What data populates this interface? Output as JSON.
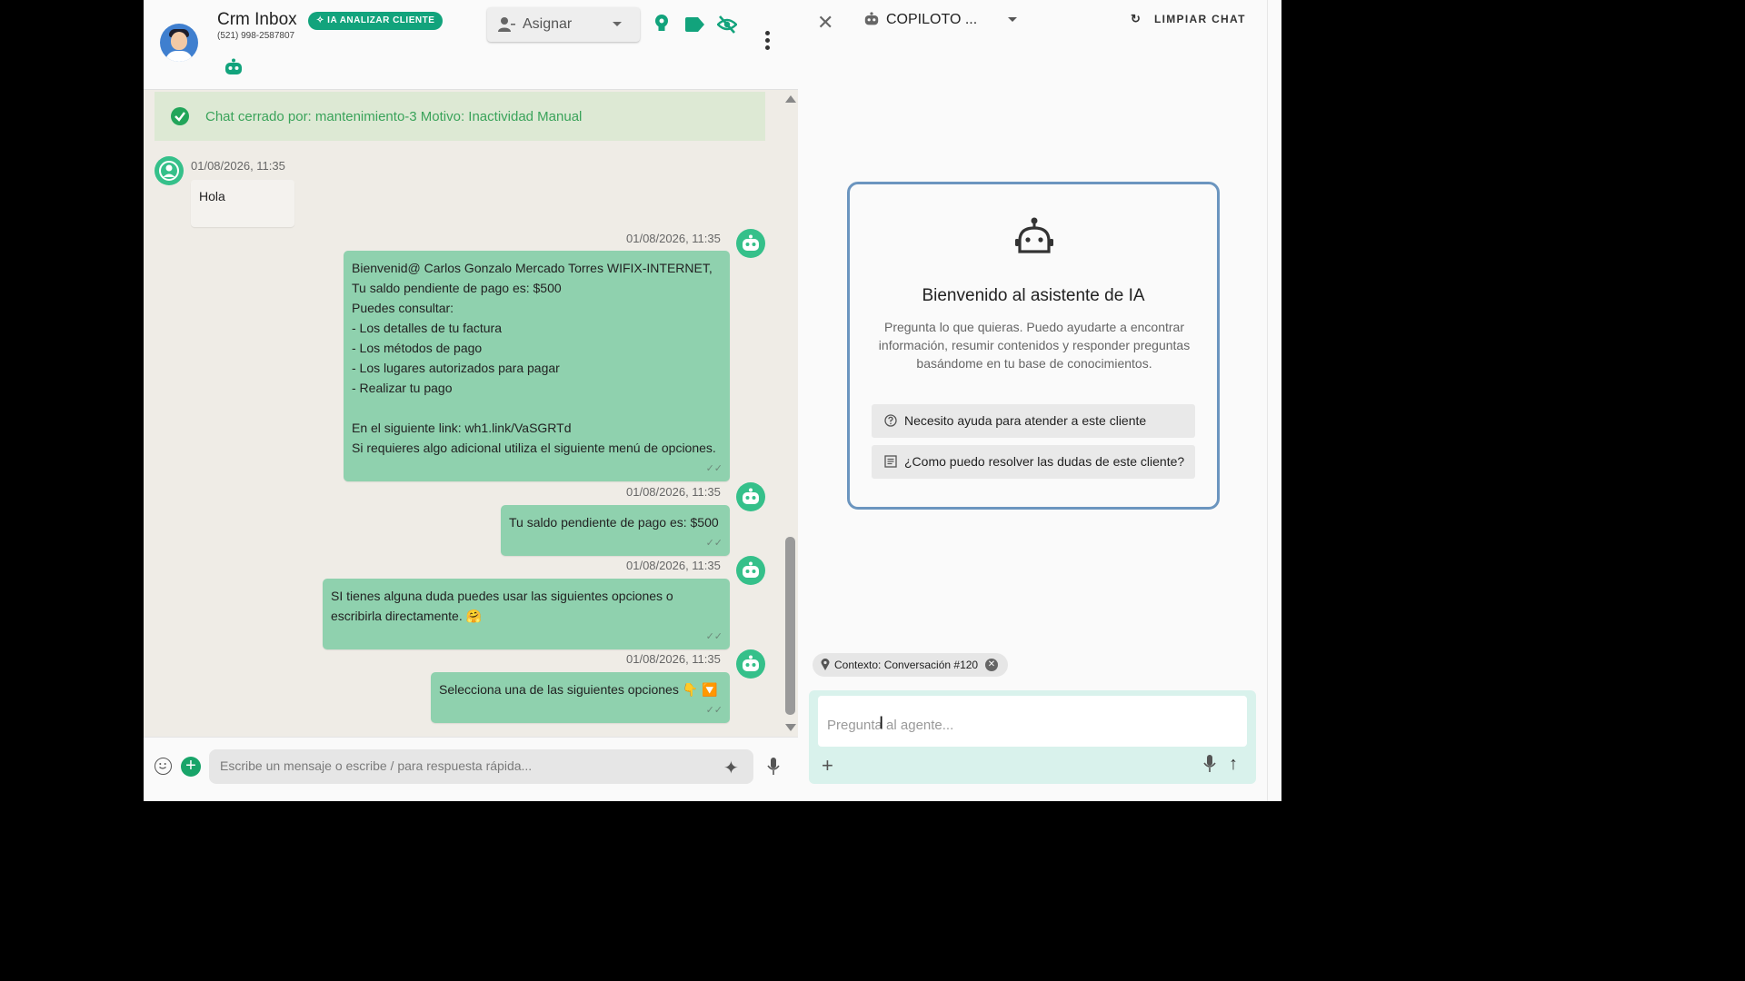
{
  "chat_header": {
    "contact_name": "Crm Inbox",
    "contact_phone": "(521) 998-2587807",
    "ai_button_label": "IA ANALIZAR CLIENTE",
    "assign_label": "Asignar"
  },
  "banner": {
    "text": "Chat cerrado por: mantenimiento-3 Motivo: Inactividad Manual"
  },
  "messages": [
    {
      "direction": "in",
      "timestamp": "01/08/2026, 11:35",
      "lines": [
        "Hola"
      ]
    },
    {
      "direction": "out",
      "timestamp": "01/08/2026, 11:35",
      "lines": [
        "Bienvenid@ Carlos Gonzalo Mercado Torres WIFIX-INTERNET,",
        "Tu saldo pendiente de pago es: $500",
        "Puedes consultar:",
        "- Los detalles de tu factura",
        "- Los métodos de pago",
        "- Los lugares autorizados para pagar",
        "- Realizar tu pago",
        "",
        "En el siguiente link: wh1.link/VaSGRTd",
        "Si requieres algo adicional utiliza el siguiente menú de opciones."
      ]
    },
    {
      "direction": "out",
      "timestamp": "01/08/2026, 11:35",
      "lines": [
        "Tu saldo pendiente de pago es: $500"
      ]
    },
    {
      "direction": "out",
      "timestamp": "01/08/2026, 11:35",
      "lines": [
        "SI tienes alguna duda puedes usar las siguientes opciones o",
        "escribirla directamente. 🤗"
      ]
    },
    {
      "direction": "out",
      "timestamp": "01/08/2026, 11:35",
      "lines": [
        "Selecciona una de las siguientes opciones 👇 🔽"
      ]
    }
  ],
  "composer": {
    "placeholder": "Escribe un mensaje o escribe / para respuesta rápida..."
  },
  "copilot": {
    "title": "COPILOTO ...",
    "clear_label": "LIMPIAR CHAT",
    "welcome_title": "Bienvenido al asistente de IA",
    "welcome_desc": "Pregunta lo que quieras. Puedo ayudarte a encontrar información, resumir contenidos y responder preguntas basándome en tu base de conocimientos.",
    "suggestions": [
      "Necesito ayuda para atender a este cliente",
      "¿Como puedo resolver las dudas de este cliente?"
    ],
    "context_chip": "Contexto: Conversación #120",
    "ask_placeholder": "Pregunta al agente..."
  },
  "colors": {
    "accent_green": "#35c08a",
    "bubble_out": "#8fd1ae",
    "ai_button": "#12a37c",
    "welcome_border": "#6b95bf"
  }
}
